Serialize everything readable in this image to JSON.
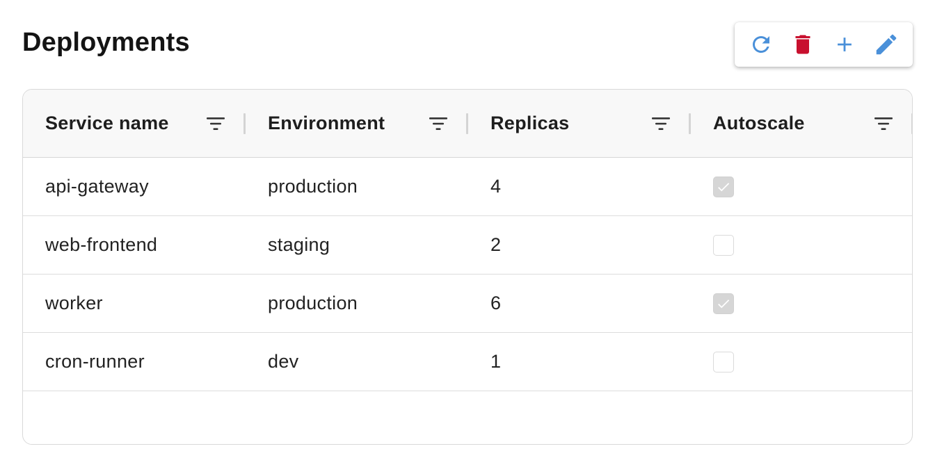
{
  "page": {
    "title": "Deployments"
  },
  "toolbar": {
    "actions": [
      {
        "name": "refresh",
        "icon": "refresh-icon",
        "color": "#4a90d9"
      },
      {
        "name": "delete",
        "icon": "trash-icon",
        "color": "#c8102e"
      },
      {
        "name": "add",
        "icon": "plus-icon",
        "color": "#4a90d9"
      },
      {
        "name": "edit",
        "icon": "pencil-icon",
        "color": "#4a90d9"
      }
    ]
  },
  "table": {
    "columns": [
      {
        "label": "Service name",
        "filter_icon": "filter-icon"
      },
      {
        "label": "Environment",
        "filter_icon": "filter-icon"
      },
      {
        "label": "Replicas",
        "filter_icon": "filter-icon"
      },
      {
        "label": "Autoscale",
        "filter_icon": "filter-icon"
      }
    ],
    "rows": [
      {
        "service": "api-gateway",
        "environment": "production",
        "replicas": "4",
        "autoscale": true
      },
      {
        "service": "web-frontend",
        "environment": "staging",
        "replicas": "2",
        "autoscale": false
      },
      {
        "service": "worker",
        "environment": "production",
        "replicas": "6",
        "autoscale": true
      },
      {
        "service": "cron-runner",
        "environment": "dev",
        "replicas": "1",
        "autoscale": false
      }
    ]
  },
  "colors": {
    "accent": "#4a90d9",
    "danger": "#c8102e",
    "checked_fill": "#d6d6d6"
  }
}
